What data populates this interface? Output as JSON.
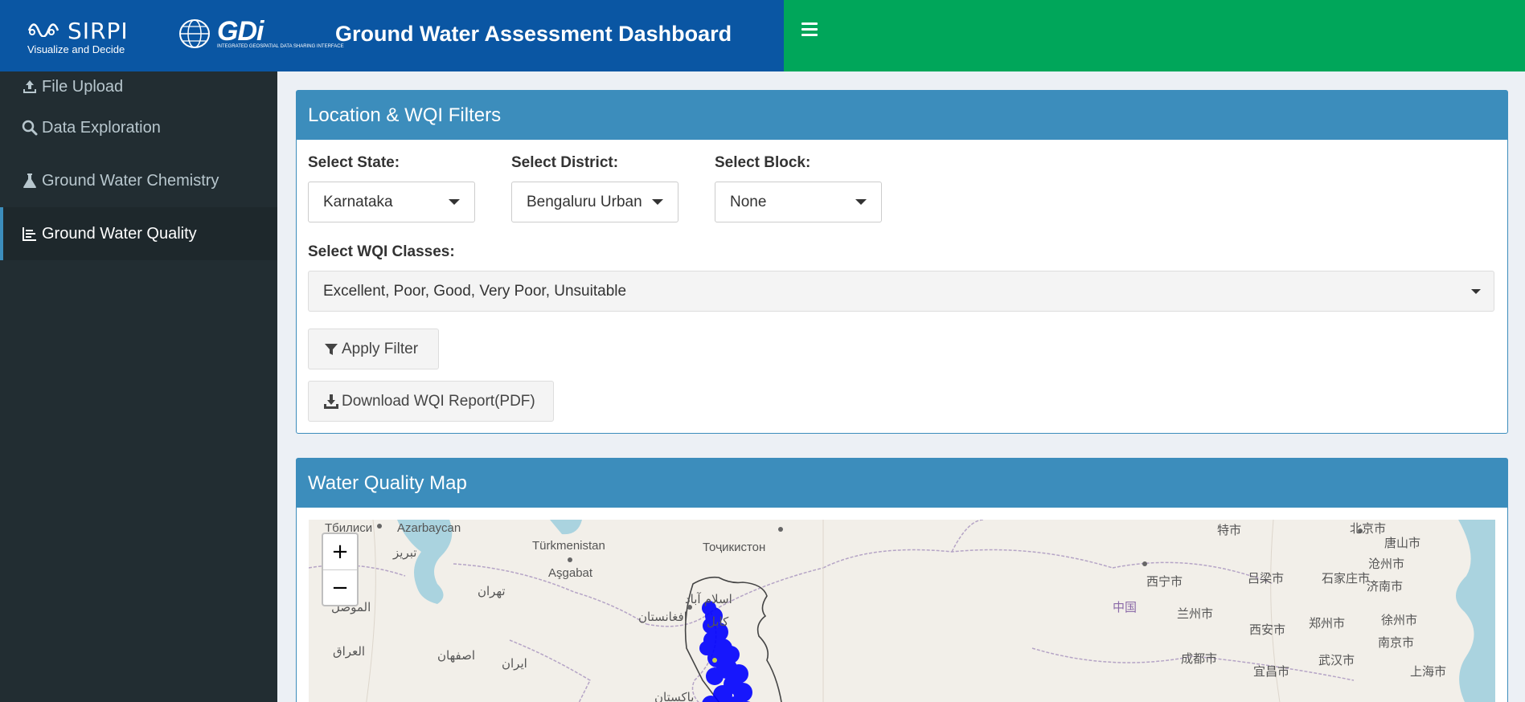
{
  "header": {
    "sirpi_logo_text": "SIRPI",
    "sirpi_tagline": "Visualize and Decide",
    "gdi_logo_text": "GDi",
    "gdi_logo_subtext": "INTEGRATED GEOSPATIAL DATA SHARING INTERFACE",
    "title": "Ground Water Assessment Dashboard"
  },
  "sidebar": {
    "items": [
      {
        "label": "File Upload",
        "icon": "upload-icon"
      },
      {
        "label": "Data Exploration",
        "icon": "search-icon"
      },
      {
        "label": "Ground Water Chemistry",
        "icon": "flask-icon"
      },
      {
        "label": "Ground Water Quality",
        "icon": "chart-icon",
        "active": true
      }
    ]
  },
  "filters": {
    "title": "Location & WQI Filters",
    "state_label": "Select State:",
    "state_value": "Karnataka",
    "district_label": "Select District:",
    "district_value": "Bengaluru Urban",
    "block_label": "Select Block:",
    "block_value": "None",
    "wqi_label": "Select WQI Classes:",
    "wqi_value": "Excellent, Poor, Good, Very Poor, Unsuitable",
    "apply_button": "Apply Filter",
    "download_button": "Download WQI Report(PDF)"
  },
  "map": {
    "title": "Water Quality Map",
    "zoom_in": "+",
    "zoom_out": "−",
    "labels": [
      "Azarbaycan",
      "تبریز",
      "Türkmenistan",
      "Aşgabat",
      "Тоҷикистон",
      "افغانستان",
      "کابل",
      "ایران",
      "العراق",
      "اصفهان",
      "تهران",
      "الموصل",
      "پاکستان",
      "اسلام آباد",
      "中国",
      "西宁市",
      "兰州市",
      "吕梁市",
      "石家庄市",
      "北京市",
      "唐山市",
      "沧州市",
      "济南市",
      "西安市",
      "郑州市",
      "徐州市",
      "南京市",
      "成都市",
      "宜昌市",
      "武汉市",
      "上海市",
      "特市",
      "Тбилиси"
    ]
  },
  "colors": {
    "brand_blue": "#0a56a3",
    "topbar_green": "#00a65a",
    "box_header_blue": "#3c8dbc",
    "sidebar_dark": "#222d32",
    "map_points": "#0000ff"
  }
}
